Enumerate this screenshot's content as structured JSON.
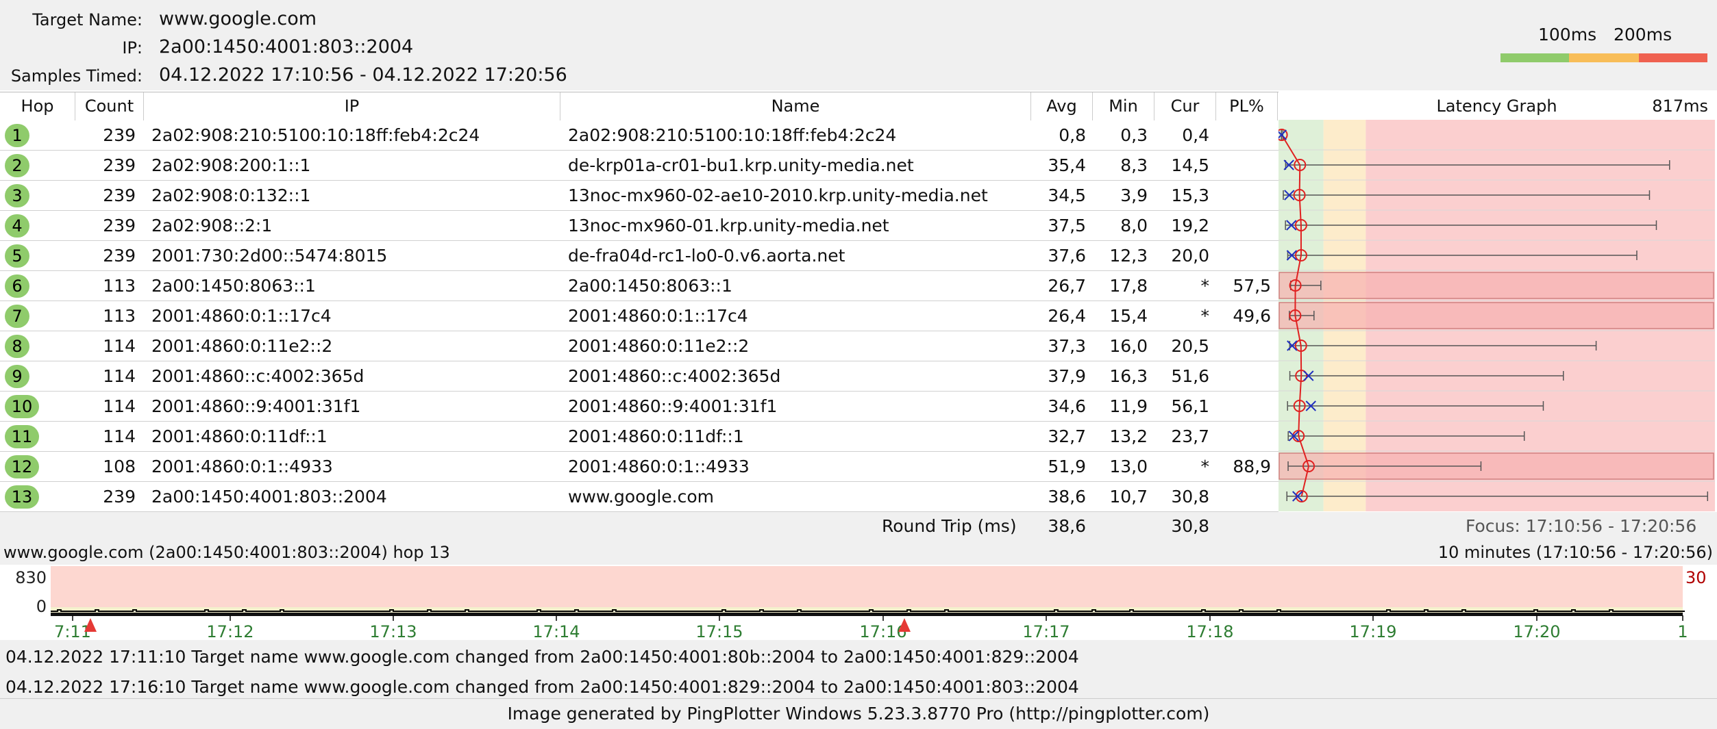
{
  "header": {
    "target_label": "Target Name:",
    "target_value": "www.google.com",
    "ip_label": "IP:",
    "ip_value": "2a00:1450:4001:803::2004",
    "samples_label": "Samples Timed:",
    "samples_value": "04.12.2022 17:10:56 - 04.12.2022 17:20:56",
    "legend_100": "100ms",
    "legend_200": "200ms",
    "legend_colors": {
      "good": "#8fcb6b",
      "warn": "#f8bd58",
      "bad": "#ef6150"
    }
  },
  "columns": {
    "hop": "Hop",
    "count": "Count",
    "ip": "IP",
    "name": "Name",
    "avg": "Avg",
    "min": "Min",
    "cur": "Cur",
    "pl": "PL%",
    "graph": "Latency Graph",
    "graph_max": "817ms"
  },
  "rows": [
    {
      "hop": "1",
      "count": "239",
      "ip": "2a02:908:210:5100:10:18ff:feb4:2c24",
      "name": "2a02:908:210:5100:10:18ff:feb4:2c24",
      "avg": "0,8",
      "min": "0,3",
      "cur": "0,4",
      "pl": ""
    },
    {
      "hop": "2",
      "count": "239",
      "ip": "2a02:908:200:1::1",
      "name": "de-krp01a-cr01-bu1.krp.unity-media.net",
      "avg": "35,4",
      "min": "8,3",
      "cur": "14,5",
      "pl": ""
    },
    {
      "hop": "3",
      "count": "239",
      "ip": "2a02:908:0:132::1",
      "name": "13noc-mx960-02-ae10-2010.krp.unity-media.net",
      "avg": "34,5",
      "min": "3,9",
      "cur": "15,3",
      "pl": ""
    },
    {
      "hop": "4",
      "count": "239",
      "ip": "2a02:908::2:1",
      "name": "13noc-mx960-01.krp.unity-media.net",
      "avg": "37,5",
      "min": "8,0",
      "cur": "19,2",
      "pl": ""
    },
    {
      "hop": "5",
      "count": "239",
      "ip": "2001:730:2d00::5474:8015",
      "name": "de-fra04d-rc1-lo0-0.v6.aorta.net",
      "avg": "37,6",
      "min": "12,3",
      "cur": "20,0",
      "pl": ""
    },
    {
      "hop": "6",
      "count": "113",
      "ip": "2a00:1450:8063::1",
      "name": "2a00:1450:8063::1",
      "avg": "26,7",
      "min": "17,8",
      "cur": "*",
      "pl": "57,5"
    },
    {
      "hop": "7",
      "count": "113",
      "ip": "2001:4860:0:1::17c4",
      "name": "2001:4860:0:1::17c4",
      "avg": "26,4",
      "min": "15,4",
      "cur": "*",
      "pl": "49,6"
    },
    {
      "hop": "8",
      "count": "114",
      "ip": "2001:4860:0:11e2::2",
      "name": "2001:4860:0:11e2::2",
      "avg": "37,3",
      "min": "16,0",
      "cur": "20,5",
      "pl": ""
    },
    {
      "hop": "9",
      "count": "114",
      "ip": "2001:4860::c:4002:365d",
      "name": "2001:4860::c:4002:365d",
      "avg": "37,9",
      "min": "16,3",
      "cur": "51,6",
      "pl": ""
    },
    {
      "hop": "10",
      "count": "114",
      "ip": "2001:4860::9:4001:31f1",
      "name": "2001:4860::9:4001:31f1",
      "avg": "34,6",
      "min": "11,9",
      "cur": "56,1",
      "pl": ""
    },
    {
      "hop": "11",
      "count": "114",
      "ip": "2001:4860:0:11df::1",
      "name": "2001:4860:0:11df::1",
      "avg": "32,7",
      "min": "13,2",
      "cur": "23,7",
      "pl": ""
    },
    {
      "hop": "12",
      "count": "108",
      "ip": "2001:4860:0:1::4933",
      "name": "2001:4860:0:1::4933",
      "avg": "51,9",
      "min": "13,0",
      "cur": "*",
      "pl": "88,9"
    },
    {
      "hop": "13",
      "count": "239",
      "ip": "2a00:1450:4001:803::2004",
      "name": "www.google.com",
      "avg": "38,6",
      "min": "10,7",
      "cur": "30,8",
      "pl": ""
    }
  ],
  "latency_graph": {
    "scale_max_ms": 817,
    "hops": [
      {
        "avg": 0.8,
        "cur": 0.4,
        "max": 3
      },
      {
        "avg": 35.4,
        "cur": 14.5,
        "max": 735
      },
      {
        "avg": 34.5,
        "cur": 15.3,
        "max": 697
      },
      {
        "avg": 37.5,
        "cur": 19.2,
        "max": 710
      },
      {
        "avg": 37.6,
        "cur": 20.0,
        "max": 673
      },
      {
        "avg": 26.7,
        "cur": null,
        "max": 75
      },
      {
        "avg": 26.4,
        "cur": null,
        "max": 62
      },
      {
        "avg": 37.3,
        "cur": 20.5,
        "max": 596
      },
      {
        "avg": 37.9,
        "cur": 51.6,
        "max": 534
      },
      {
        "avg": 34.6,
        "cur": 56.1,
        "max": 496
      },
      {
        "avg": 32.7,
        "cur": 23.7,
        "max": 460
      },
      {
        "avg": 51.9,
        "cur": null,
        "max": 378
      },
      {
        "avg": 38.6,
        "cur": 30.8,
        "max": 807
      }
    ]
  },
  "round_trip": {
    "label": "Round Trip (ms)",
    "avg": "38,6",
    "cur": "30,8",
    "focus": "Focus: 17:10:56 - 17:20:56"
  },
  "timeline": {
    "title": "www.google.com (2a00:1450:4001:803::2004) hop 13",
    "range": "10 minutes (17:10:56 - 17:20:56)",
    "y_top": "830",
    "y_bottom": "0",
    "right_value": "30",
    "ticks": [
      "7:11",
      "17:12",
      "17:13",
      "17:14",
      "17:15",
      "17:16",
      "17:17",
      "17:18",
      "17:19",
      "17:20",
      "1"
    ]
  },
  "events": [
    "04.12.2022 17:11:10 Target name www.google.com changed from 2a00:1450:4001:80b::2004 to 2a00:1450:4001:829::2004",
    "04.12.2022 17:16:10 Target name www.google.com changed from 2a00:1450:4001:829::2004 to 2a00:1450:4001:803::2004"
  ],
  "footer": "Image generated by PingPlotter Windows 5.23.3.8770 Pro (http://pingplotter.com)"
}
